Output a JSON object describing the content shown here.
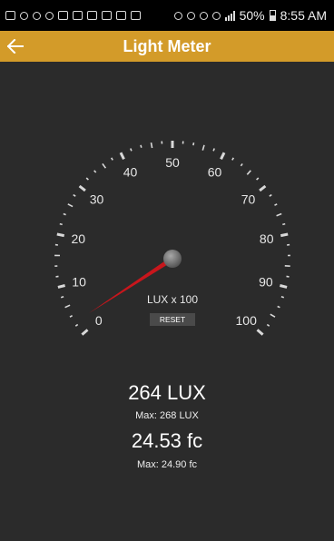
{
  "status_bar": {
    "battery": "50%",
    "time": "8:55 AM"
  },
  "app_bar": {
    "title": "Light Meter",
    "back_icon": "arrow-left-icon"
  },
  "gauge": {
    "min": 0,
    "max": 100,
    "labels": [
      "0",
      "10",
      "20",
      "30",
      "40",
      "50",
      "60",
      "70",
      "80",
      "90",
      "100"
    ],
    "needle_value": 2.64,
    "unit_label": "LUX x 100",
    "needle_color": "#c8161c",
    "reset_label": "RESET"
  },
  "readings": {
    "lux": "264 LUX",
    "lux_max": "Max: 268 LUX",
    "fc": "24.53 fc",
    "fc_max": "Max: 24.90 fc"
  },
  "colors": {
    "app_bar": "#d39b29",
    "background": "#2b2b2b"
  }
}
